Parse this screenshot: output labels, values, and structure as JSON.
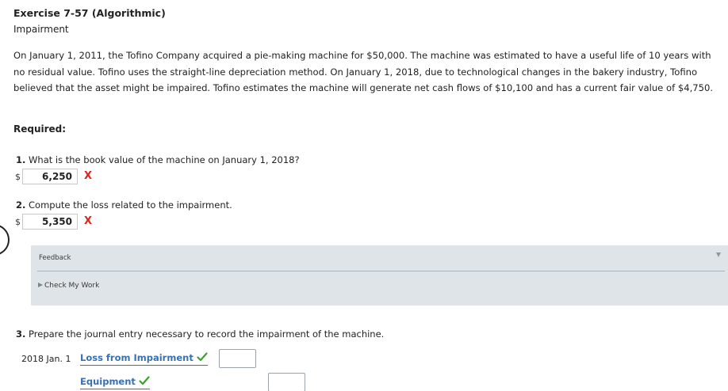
{
  "exercise": {
    "title": "Exercise 7-57 (Algorithmic)",
    "subtitle": "Impairment"
  },
  "problem_text": "On January 1, 2011, the Tofino Company acquired a pie-making machine for $50,000. The machine was estimated to have a useful life of 10 years with no residual value. Tofino uses the straight-line depreciation method. On January 1, 2018, due to technological changes in the bakery industry, Tofino believed that the asset might be impaired. Tofino estimates the machine will generate net cash flows of $10,100 and has a current fair value of $4,750.",
  "required_label": "Required:",
  "questions": [
    {
      "number": "1.",
      "text": "What is the book value of the machine on January 1, 2018?",
      "currency": "$",
      "answer": "6,250",
      "status_mark": "X"
    },
    {
      "number": "2.",
      "text": "Compute the loss related to the impairment.",
      "currency": "$",
      "answer": "5,350",
      "status_mark": "X"
    },
    {
      "number": "3.",
      "text": "Prepare the journal entry necessary to record the impairment of the machine."
    }
  ],
  "feedback": {
    "label": "Feedback",
    "check_work": "Check My Work"
  },
  "journal": {
    "date": "2018 Jan. 1",
    "rows": [
      {
        "account": "Loss from Impairment",
        "amount": ""
      },
      {
        "account": "Equipment",
        "amount": ""
      }
    ]
  },
  "colors": {
    "incorrect": "#e0241b",
    "correct": "#3aa22b",
    "account_link": "#3a6fb0",
    "feedback_bg": "#dfe4e8"
  },
  "icons": {
    "incorrect": "x-mark-icon",
    "correct": "checkmark-icon",
    "expand": "triangle-down-icon",
    "disclosure": "triangle-right-icon"
  }
}
